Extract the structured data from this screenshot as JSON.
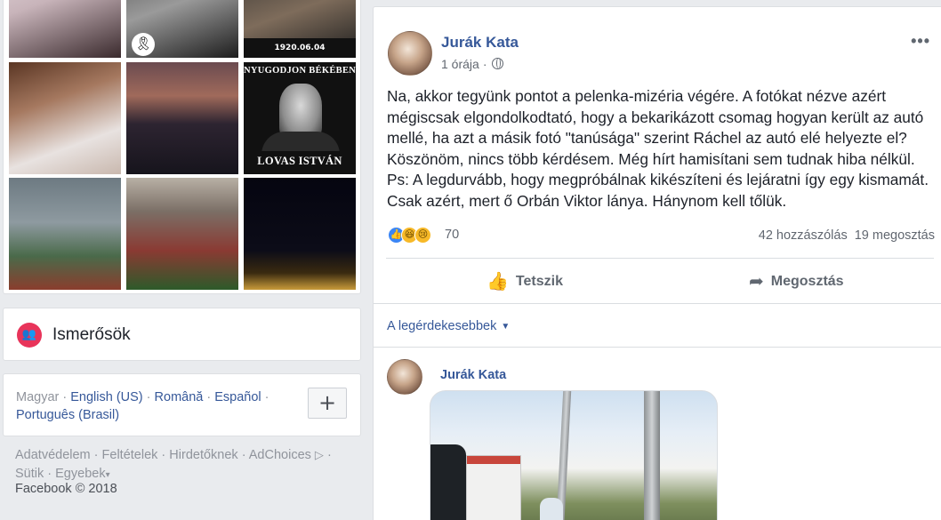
{
  "photos": {
    "tiles": [
      {
        "alt": "woman-portrait-1"
      },
      {
        "alt": "mourning-ribbon-photo"
      },
      {
        "alt": "black-ribbon-1920",
        "date": "1920.06.04"
      },
      {
        "alt": "woman-portrait-2"
      },
      {
        "alt": "city-at-dusk"
      },
      {
        "alt": "memorial-card",
        "top": "NYUGODJON BÉKÉBEN",
        "name": "LOVAS ISTVÁN"
      },
      {
        "alt": "church-rainbow"
      },
      {
        "alt": "crowd-with-flags"
      },
      {
        "alt": "parliament-night"
      }
    ]
  },
  "friends": {
    "label": "Ismerősök",
    "icon": "friends-icon"
  },
  "languages": {
    "current": "Magyar",
    "items": [
      "English (US)",
      "Română",
      "Español",
      "Português (Brasil)"
    ],
    "sep": " · ",
    "add_label": "+"
  },
  "footer": {
    "links": [
      "Adatvédelem",
      "Feltételek",
      "Hirdetőknek",
      "AdChoices",
      "Sütik",
      "Egyebek"
    ],
    "sep": " · ",
    "more_caret": "▾",
    "copyright": "Facebook © 2018"
  },
  "post": {
    "author": "Jurák Kata",
    "time": "1 órája",
    "more": "•••",
    "body": "Na, akkor tegyünk pontot a pelenka-mizéria végére. A fotókat nézve azért mégiscsak elgondolkodtató, hogy a bekarikázott csomag hogyan került az autó mellé, ha azt a másik fotó \"tanúsága\" szerint Ráchel az autó elé helyezte el? Köszönöm, nincs több kérdésem. Még hírt hamisítani sem tudnak hiba nélkül. Ps: A legdurvább, hogy megpróbálnak kikészíteni és lejáratni így egy kismamát. Csak azért, mert ő Orbán Viktor lánya. Hánynom kell tőlük.",
    "reactions": {
      "count": "70",
      "types": [
        "like",
        "haha",
        "sad"
      ]
    },
    "comments": "42 hozzászólás",
    "shares": "19 megosztás",
    "like_label": "Tetszik",
    "share_label": "Megosztás",
    "sort_label": "A legérdekesebbek",
    "comment": {
      "author": "Jurák Kata"
    }
  },
  "colors": {
    "link": "#365899",
    "bg": "#e9ebee",
    "friends_icon_bg": "#e8345a"
  }
}
